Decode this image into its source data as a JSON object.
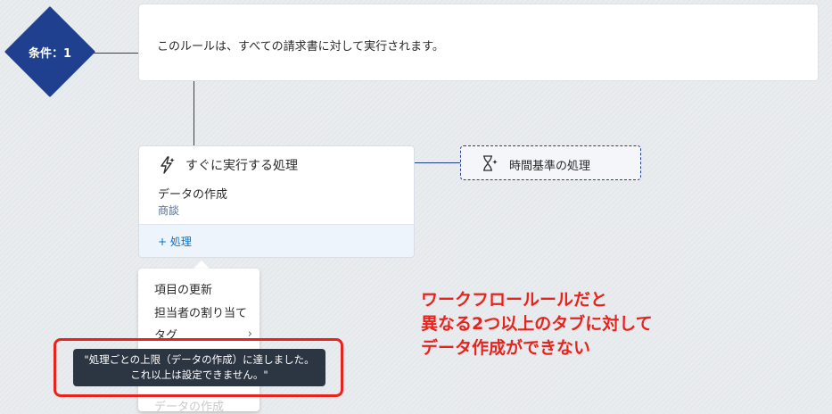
{
  "condition": {
    "label": "条件：1",
    "description": "このルールは、すべての請求書に対して実行されます。"
  },
  "immediate_action": {
    "header": "すぐに実行する処理",
    "action_name": "データの作成",
    "action_object": "商談",
    "add_label": "+ 処理"
  },
  "time_based_action": {
    "label": "時間基準の処理"
  },
  "menu": {
    "items": [
      "項目の更新",
      "担当者の割り当て",
      "タグ"
    ],
    "disabled_item": "データの作成",
    "chevron": "›"
  },
  "tooltip": {
    "line1": "\"処理ごとの上限（データの作成）に達しました。",
    "line2": "これ以上は設定できません。\""
  },
  "annotation": {
    "line1": "ワークフロールールだと",
    "line2": "異なる2つ以上のタブに対して",
    "line3": "データ作成ができない"
  },
  "colors": {
    "brand_navy": "#1f3f8f",
    "annotation_red": "#e8231d",
    "link_blue": "#0070d2"
  }
}
